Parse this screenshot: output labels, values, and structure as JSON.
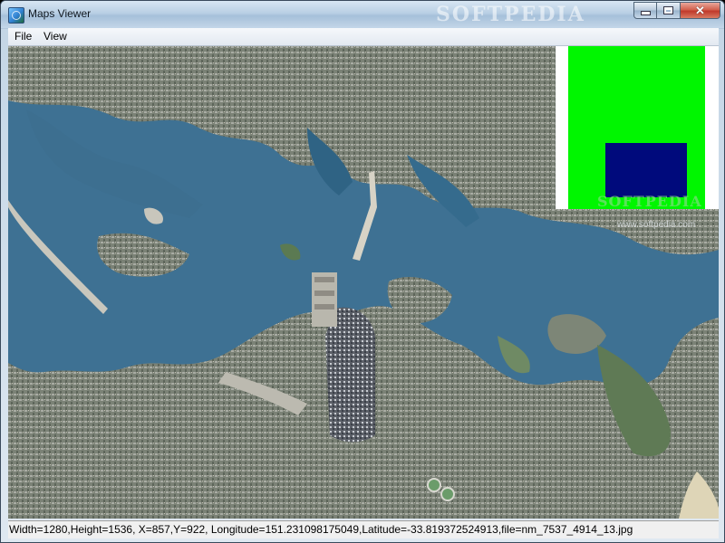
{
  "window": {
    "title": "Maps Viewer",
    "background_watermark": "SOFTPEDIA",
    "caption_buttons": {
      "minimize": "minimize",
      "maximize": "maximize",
      "close": "✕"
    }
  },
  "menubar": {
    "items": [
      "File",
      "View"
    ]
  },
  "map": {
    "image_description_icon": "aerial-map-image",
    "minimap": {
      "colors": {
        "background": "#ffffff",
        "area": "#00f600",
        "viewport": "#000a7c"
      }
    },
    "watermark": "SOFTPEDIA",
    "watermark_url": "www.softpedia.com"
  },
  "statusbar": {
    "text": "Width=1280,Height=1536, X=857,Y=922, Longitude=151.231098175049,Latitude=-33.819372524913,file=nm_7537_4914_13.jpg"
  },
  "colors": {
    "water": "#3e7193",
    "land": "#7f8775",
    "dense_city": "#5f6670"
  }
}
